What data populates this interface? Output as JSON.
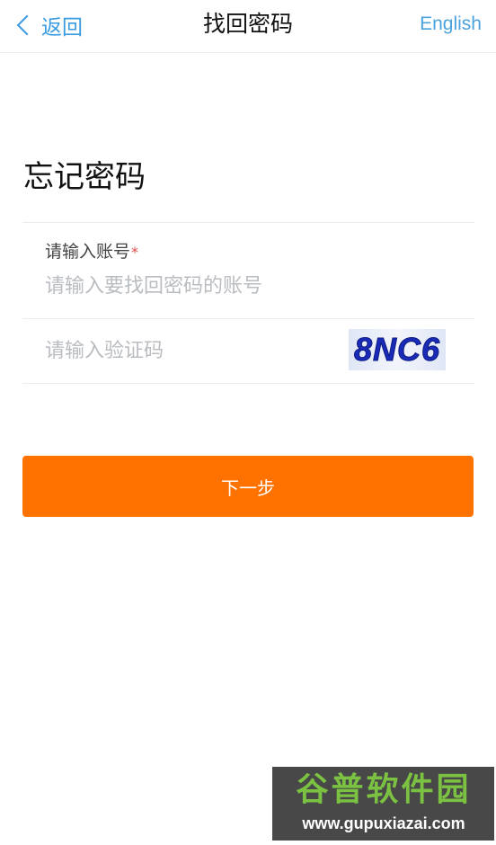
{
  "nav": {
    "back_label": "返回",
    "title": "找回密码",
    "language_label": "English"
  },
  "page": {
    "heading": "忘记密码"
  },
  "form": {
    "account_label": "请输入账号",
    "required_mark": "*",
    "account_placeholder": "请输入要找回密码的账号",
    "account_value": "",
    "captcha_placeholder": "请输入验证码",
    "captcha_value": "",
    "captcha_text": "8NC6",
    "submit_label": "下一步"
  },
  "watermark": {
    "title": "谷普软件园",
    "url": "www.gupuxiazai.com"
  },
  "colors": {
    "accent_blue": "#3a9be0",
    "primary_button": "#ff7200",
    "required": "#e34a4a",
    "captcha_ink": "#1a2bb8"
  }
}
